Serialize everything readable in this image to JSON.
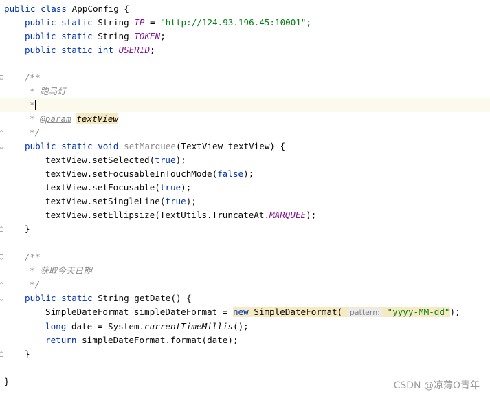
{
  "code": {
    "class_decl": [
      "public",
      "class",
      "AppConfig {"
    ],
    "field_ip": [
      "public",
      "static",
      "String",
      "IP",
      " = ",
      "\"http://124.93.196.45:10001\"",
      ";"
    ],
    "field_token": [
      "public",
      "static",
      "String",
      "TOKEN",
      ";"
    ],
    "field_userid": [
      "public",
      "static",
      "int",
      "USERID",
      ";"
    ],
    "doc1": [
      "/**",
      "* 跑马灯",
      "*",
      "*",
      "@param",
      "textView",
      "*/"
    ],
    "marquee_sig": [
      "public",
      "static",
      "void",
      "setMarquee",
      "(TextView textView) {"
    ],
    "marquee_body": [
      [
        "textView.setSelected(",
        "true",
        ");"
      ],
      [
        "textView.setFocusableInTouchMode(",
        "false",
        ");"
      ],
      [
        "textView.setFocusable(",
        "true",
        ");"
      ],
      [
        "textView.setSingleLine(",
        "true",
        ");"
      ],
      [
        "textView.setEllipsize(TextUtils.TruncateAt.",
        "MARQUEE",
        ");"
      ]
    ],
    "close_brace": "}",
    "doc2": [
      "/**",
      "* 获取今天日期",
      "*/"
    ],
    "getdate_sig": [
      "public",
      "static",
      "String",
      "getDate",
      "() {"
    ],
    "getdate_body": {
      "l1": [
        "SimpleDateFormat simpleDateFormat = ",
        "new",
        "SimpleDateFormat(",
        "pattern:",
        "\"yyyy-MM-dd\"",
        ");"
      ],
      "l2": [
        "long",
        "date = System.",
        "currentTimeMillis",
        "();"
      ],
      "l3": [
        "return",
        "simpleDateFormat.format(date);"
      ]
    }
  },
  "watermark": "CSDN @凉薄O青年",
  "colors": {
    "keyword": "#0033b3",
    "string": "#067d17",
    "static_field": "#871094",
    "comment": "#8c8c8c",
    "current_line": "#fcfaed",
    "highlight": "#f5eac1"
  }
}
